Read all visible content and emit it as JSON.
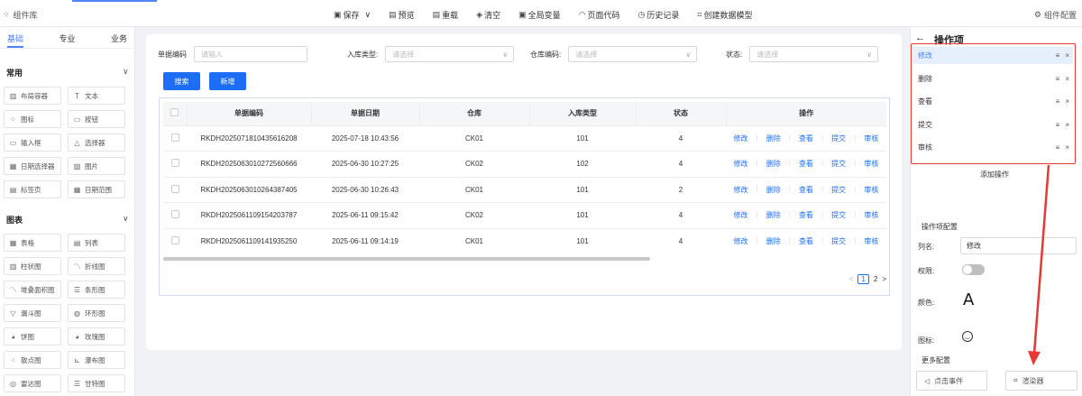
{
  "topbar": {
    "left_label": "组件库",
    "right_label": "组件配置",
    "toolbar": [
      {
        "icon": "save-icon",
        "glyph": "▣",
        "label": "保存",
        "suffix": "∨"
      },
      {
        "icon": "preview-icon",
        "glyph": "▤",
        "label": "预览",
        "suffix": ""
      },
      {
        "icon": "reload-icon",
        "glyph": "▤",
        "label": "重载",
        "suffix": ""
      },
      {
        "icon": "clear-icon",
        "glyph": "◈",
        "label": "清空",
        "suffix": ""
      },
      {
        "icon": "global-var-icon",
        "glyph": "▣",
        "label": "全局变量",
        "suffix": ""
      },
      {
        "icon": "code-icon",
        "glyph": "◠",
        "label": "页面代码",
        "suffix": ""
      },
      {
        "icon": "history-icon",
        "glyph": "◷",
        "label": "历史记录",
        "suffix": ""
      },
      {
        "icon": "data-model-icon",
        "glyph": "⌗",
        "label": "创建数据模型",
        "suffix": ""
      }
    ]
  },
  "left_panel": {
    "tabs": [
      "基础",
      "专业",
      "业务"
    ],
    "groups": [
      {
        "title": "常用",
        "items": [
          {
            "icon": "layout-icon",
            "glyph": "▥",
            "label": "布局容器"
          },
          {
            "icon": "text-icon",
            "glyph": "T",
            "label": "文本"
          },
          {
            "icon": "grid-icon",
            "glyph": "⁘",
            "label": "图标"
          },
          {
            "icon": "button-icon",
            "glyph": "▭",
            "label": "按钮"
          },
          {
            "icon": "input-icon",
            "glyph": "▭",
            "label": "输入框"
          },
          {
            "icon": "select-icon",
            "glyph": "△",
            "label": "选择器"
          },
          {
            "icon": "date-icon",
            "glyph": "▦",
            "label": "日期选择器"
          },
          {
            "icon": "image-icon",
            "glyph": "▨",
            "label": "图片"
          },
          {
            "icon": "tabs-icon",
            "glyph": "▤",
            "label": "标签页"
          },
          {
            "icon": "date-range-icon",
            "glyph": "▦",
            "label": "日期范围"
          }
        ]
      },
      {
        "title": "图表",
        "items": [
          {
            "icon": "table-icon",
            "glyph": "▦",
            "label": "表格"
          },
          {
            "icon": "list-icon",
            "glyph": "▤",
            "label": "列表"
          },
          {
            "icon": "bar-chart-icon",
            "glyph": "▥",
            "label": "柱状图"
          },
          {
            "icon": "line-chart-icon",
            "glyph": "〽",
            "label": "折线图"
          },
          {
            "icon": "stacked-area-icon",
            "glyph": "〽",
            "label": "堆叠面积图"
          },
          {
            "icon": "hbar-chart-icon",
            "glyph": "☰",
            "label": "条形图"
          },
          {
            "icon": "funnel-icon",
            "glyph": "▽",
            "label": "漏斗图"
          },
          {
            "icon": "ring-chart-icon",
            "glyph": "◍",
            "label": "环形图"
          },
          {
            "icon": "pie-chart-icon",
            "glyph": "◕",
            "label": "饼图"
          },
          {
            "icon": "rose-chart-icon",
            "glyph": "◕",
            "label": "玫瑰图"
          },
          {
            "icon": "scatter-icon",
            "glyph": "⁖",
            "label": "散点图"
          },
          {
            "icon": "waterfall-icon",
            "glyph": "⊾",
            "label": "瀑布图"
          },
          {
            "icon": "radar-icon",
            "glyph": "◎",
            "label": "雷达图"
          },
          {
            "icon": "gantt-icon",
            "glyph": "☰",
            "label": "甘特图"
          }
        ]
      }
    ]
  },
  "filters": [
    {
      "label": "单据编码",
      "placeholder": "请输入",
      "dropdown": false
    },
    {
      "label": "入库类型:",
      "placeholder": "请选择",
      "dropdown": true
    },
    {
      "label": "仓库编码:",
      "placeholder": "请选择",
      "dropdown": true
    },
    {
      "label": "状态:",
      "placeholder": "请选择",
      "dropdown": true
    }
  ],
  "buttons": {
    "search": "搜索",
    "add": "新增"
  },
  "table": {
    "headers": [
      "单据编码",
      "单据日期",
      "仓库",
      "入库类型",
      "状态",
      "操作"
    ],
    "rows": [
      [
        "RKDH2025071810435616208",
        "2025-07-18 10:43:56",
        "CK01",
        "101",
        "4"
      ],
      [
        "RKDH2025063010272560666",
        "2025-06-30 10:27:25",
        "CK02",
        "102",
        "4"
      ],
      [
        "RKDH2025063010264387405",
        "2025-06-30 10:26:43",
        "CK01",
        "101",
        "2"
      ],
      [
        "RKDH2025061109154203787",
        "2025-06-11 09:15:42",
        "CK02",
        "101",
        "4"
      ],
      [
        "RKDH2025061109141935250",
        "2025-06-11 09:14:19",
        "CK01",
        "101",
        "4"
      ]
    ],
    "row_actions": [
      "修改",
      "删除",
      "查看",
      "提交",
      "审核"
    ]
  },
  "pagination": {
    "prev": "<",
    "pages": [
      "1",
      "2"
    ],
    "next": ">"
  },
  "right_panel": {
    "title": "操作项",
    "back": "←",
    "operations": [
      "修改",
      "删除",
      "查看",
      "提交",
      "审核"
    ],
    "row_icons": {
      "drag": "≡",
      "remove": "×"
    },
    "add_operation": "添加操作",
    "config_title": "操作项配置",
    "column_name_label": "列名:",
    "column_name_value": "修改",
    "permission_label": "权限:",
    "color_label": "颜色:",
    "color_glyph": "A",
    "icon_label": "图标:",
    "more_config": "更多配置",
    "click_event": "点击事件",
    "renderer": "渲染器",
    "highlight_color": "#e53935",
    "accent_color": "#4e84f7"
  }
}
